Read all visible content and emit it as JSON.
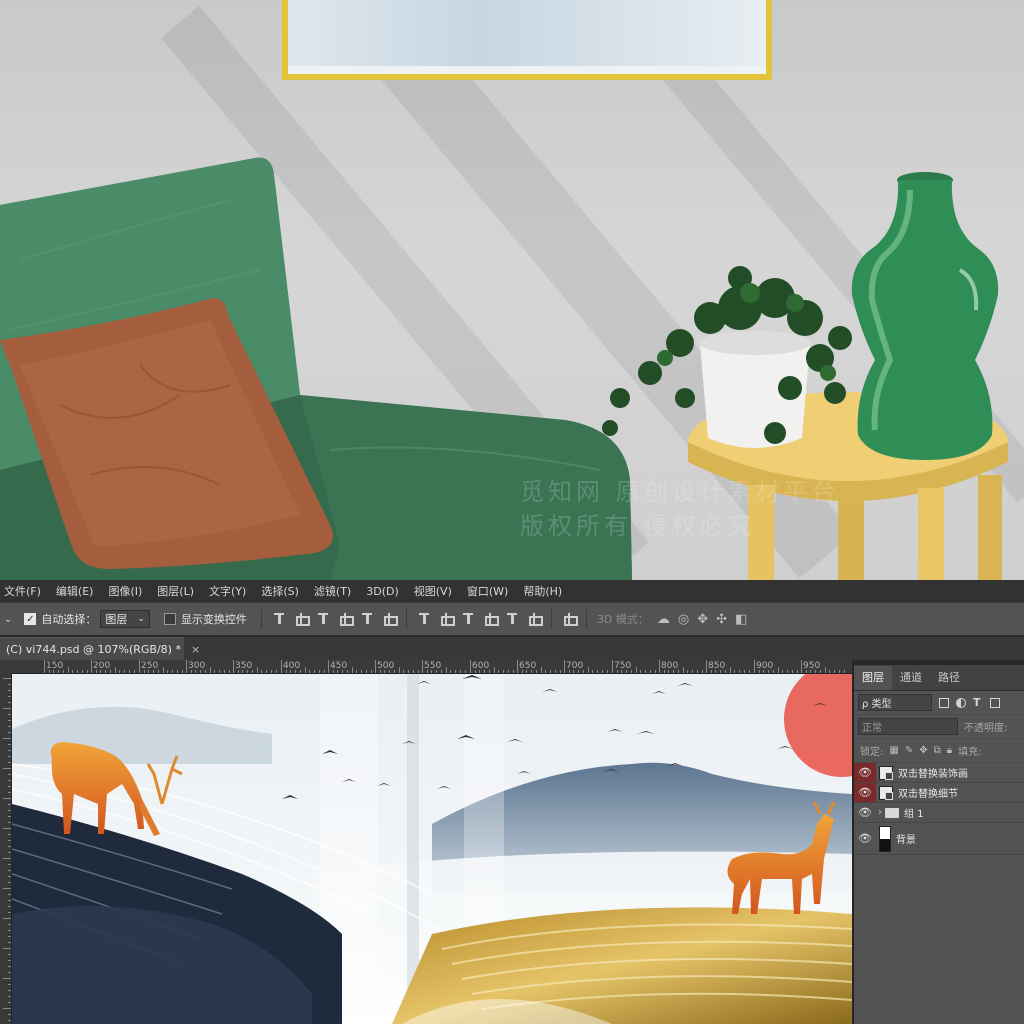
{
  "menu": {
    "items": [
      "文件(F)",
      "编辑(E)",
      "图像(I)",
      "图层(L)",
      "文字(Y)",
      "选择(S)",
      "滤镜(T)",
      "3D(D)",
      "视图(V)",
      "窗口(W)",
      "帮助(H)"
    ]
  },
  "options_bar": {
    "auto_select_label": "自动选择：",
    "auto_select_checked": true,
    "auto_select_target": "图层",
    "show_transform_label": "显示变换控件",
    "mode_3d_label": "3D 模式："
  },
  "document": {
    "tab_title": "(C) vi744.psd @ 107%(RGB/8) *",
    "close_glyph": "×"
  },
  "rulers": {
    "top_labels": [
      "150",
      "200",
      "250",
      "300",
      "350",
      "400",
      "450",
      "500",
      "550",
      "600",
      "650",
      "700",
      "750",
      "800",
      "850",
      "900",
      "950"
    ]
  },
  "layers_panel": {
    "tabs": [
      "图层",
      "通道",
      "路径"
    ],
    "active_tab": "图层",
    "filter_label": "ρ 类型",
    "blend_mode": "正常",
    "opacity_label": "不透明度:",
    "lock_label": "锁定:",
    "fill_label": "填充:",
    "layers": [
      {
        "name": "双击替换装饰画",
        "type": "smart",
        "visible": true,
        "highlighted": true
      },
      {
        "name": "双击替换细节",
        "type": "smart",
        "visible": true,
        "highlighted": true
      },
      {
        "name": "组 1",
        "type": "group",
        "visible": true,
        "highlighted": false
      },
      {
        "name": "背景",
        "type": "background",
        "visible": true,
        "highlighted": false
      }
    ]
  },
  "mockup": {
    "watermark_lines": [
      "觅知网 原创设计素材平台",
      "版权所有 侵权必究"
    ]
  },
  "colors": {
    "accent_red": "#7a2a2a",
    "frame_gold": "#e2c43a",
    "sofa_green": "#3f7d5a",
    "table_yellow": "#ecc96a"
  }
}
